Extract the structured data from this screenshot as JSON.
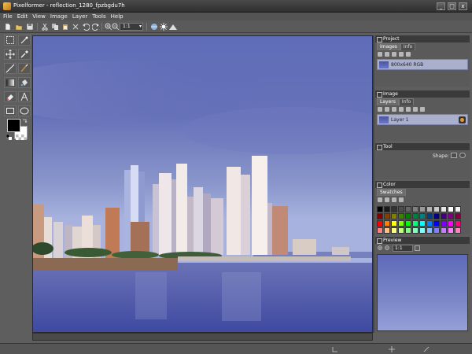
{
  "window": {
    "title": "Pixelformer - reflection_1280_fpzbgdu7h",
    "minimize_glyph": "_",
    "maximize_glyph": "□",
    "close_glyph": "x"
  },
  "menu": [
    "File",
    "Edit",
    "View",
    "Image",
    "Layer",
    "Tools",
    "Help"
  ],
  "toolbar": {
    "zoom_value": "1:1",
    "icons": [
      "new-icon",
      "open-icon",
      "save-icon",
      "cut-icon",
      "copy-icon",
      "paste-icon",
      "delete-icon",
      "undo-icon",
      "redo-icon",
      "zoom-in-icon",
      "zoom-out-icon",
      "hue-icon",
      "brightness-icon",
      "levels-icon"
    ]
  },
  "tools": [
    "rect-select-icon",
    "magic-wand-icon",
    "move-icon",
    "eyedropper-icon",
    "line-icon",
    "brush-icon",
    "gradient-icon",
    "fill-icon",
    "eraser-icon",
    "text-icon",
    "rectangle-icon",
    "ellipse-icon"
  ],
  "colors": {
    "foreground": "#000000",
    "background": "#ffffff"
  },
  "panels": {
    "project": {
      "title": "Project",
      "tabs": [
        "Images",
        "Info"
      ],
      "active_tab": "Images",
      "items": [
        {
          "label": "800x640 RGB"
        }
      ]
    },
    "image": {
      "title": "Image",
      "tabs": [
        "Layers",
        "Info"
      ],
      "active_tab": "Layers",
      "items": [
        {
          "label": "Layer 1"
        }
      ]
    },
    "tool": {
      "title": "Tool",
      "shape_label": "Shape:"
    },
    "color": {
      "title": "Color",
      "tabs": [
        "Swatches"
      ],
      "active_tab": "Swatches",
      "palette": [
        "#000000",
        "#1a1a1a",
        "#333333",
        "#4d4d4d",
        "#666666",
        "#808080",
        "#999999",
        "#b3b3b3",
        "#cccccc",
        "#e6e6e6",
        "#ffffff",
        "#f0f0f0",
        "#800000",
        "#804000",
        "#808000",
        "#408000",
        "#008000",
        "#008040",
        "#008080",
        "#004080",
        "#000080",
        "#400080",
        "#800080",
        "#800040",
        "#ff0000",
        "#ff8000",
        "#ffff00",
        "#80ff00",
        "#00ff00",
        "#00ff80",
        "#00ffff",
        "#0080ff",
        "#0000ff",
        "#8000ff",
        "#ff00ff",
        "#ff0080",
        "#ff8080",
        "#ffc080",
        "#ffff80",
        "#c0ff80",
        "#80ff80",
        "#80ffc0",
        "#80ffff",
        "#80c0ff",
        "#8080ff",
        "#c080ff",
        "#ff80ff",
        "#ff80c0"
      ]
    },
    "preview": {
      "title": "Preview",
      "zoom_value": "1:1"
    }
  }
}
